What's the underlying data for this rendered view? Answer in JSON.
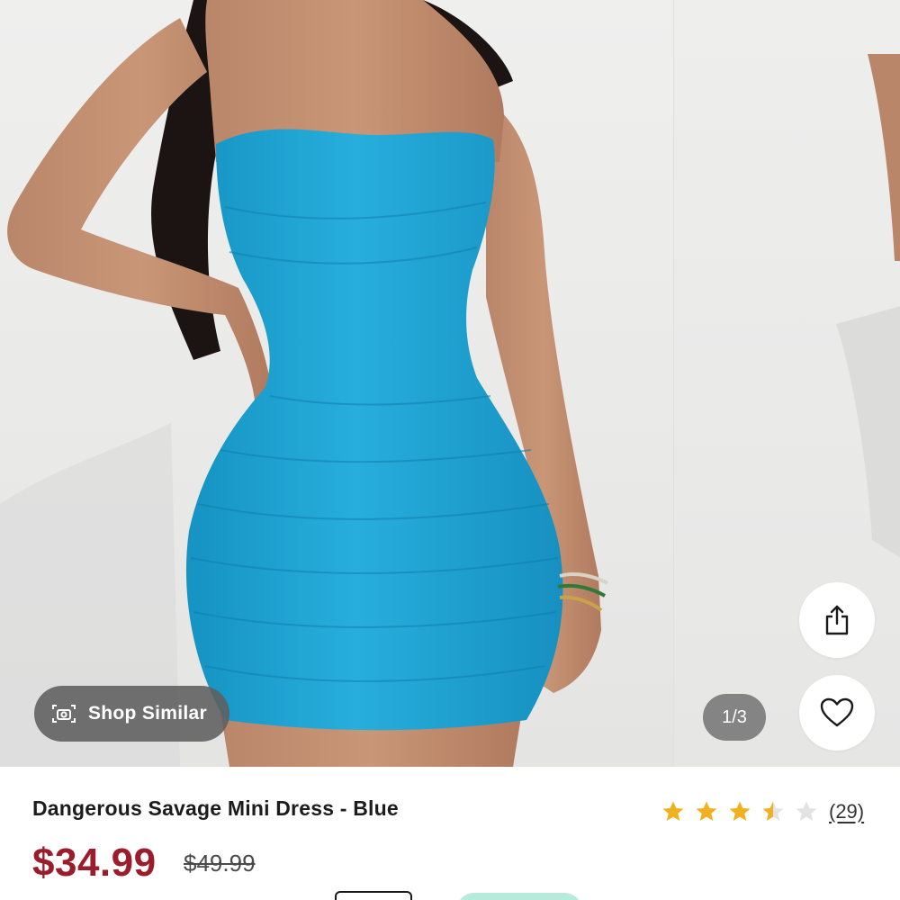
{
  "gallery": {
    "counter": "1/3",
    "shop_similar_label": "Shop Similar",
    "icons": {
      "camera": "camera-icon",
      "share": "share-icon",
      "heart": "heart-icon"
    },
    "dress_color": "#1fa6d4"
  },
  "product": {
    "title": "Dangerous Savage Mini Dress - Blue",
    "price": "$34.99",
    "original_price": "$49.99",
    "rating": 3.5,
    "rating_max": 5,
    "review_count": "(29)",
    "price_color": "#9b1c2a",
    "star_color": "#f0b020"
  }
}
